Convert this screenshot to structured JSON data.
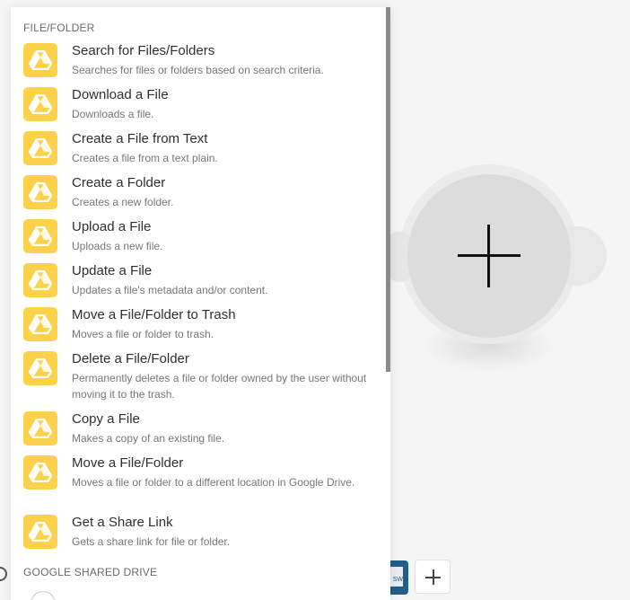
{
  "sections": [
    {
      "title": "FILE/FOLDER"
    },
    {
      "title": "GOOGLE SHARED DRIVE"
    }
  ],
  "items": [
    {
      "title": "Search for Files/Folders",
      "desc": "Searches for files or folders based on search criteria."
    },
    {
      "title": "Download a File",
      "desc": "Downloads a file."
    },
    {
      "title": "Create a File from Text",
      "desc": "Creates a file from a text plain."
    },
    {
      "title": "Create a Folder",
      "desc": "Creates a new folder."
    },
    {
      "title": "Upload a File",
      "desc": "Uploads a new file."
    },
    {
      "title": "Update a File",
      "desc": "Updates a file's metadata and/or content."
    },
    {
      "title": "Move a File/Folder to Trash",
      "desc": "Moves a file or folder to trash."
    },
    {
      "title": "Delete a File/Folder",
      "desc": "Permanently deletes a file or folder owned by the user without moving it to the trash."
    },
    {
      "title": "Copy a File",
      "desc": "Makes a copy of an existing file."
    },
    {
      "title": "Move a File/Folder",
      "desc": "Moves a file or folder to a different location in Google Drive."
    },
    {
      "title": "Get a Share Link",
      "desc": "Gets a share link for file or folder."
    }
  ],
  "toolbar": {
    "doc_badge": "SW"
  },
  "icons": {
    "item": "google-drive-icon",
    "module_add": "plus-icon",
    "toolbar_add": "plus-icon",
    "settings": "gear-icon"
  },
  "colors": {
    "icon_bg": "#fdd24a",
    "module_core": "#dcdcdc",
    "doc_thumb": "#1f5f8b"
  }
}
